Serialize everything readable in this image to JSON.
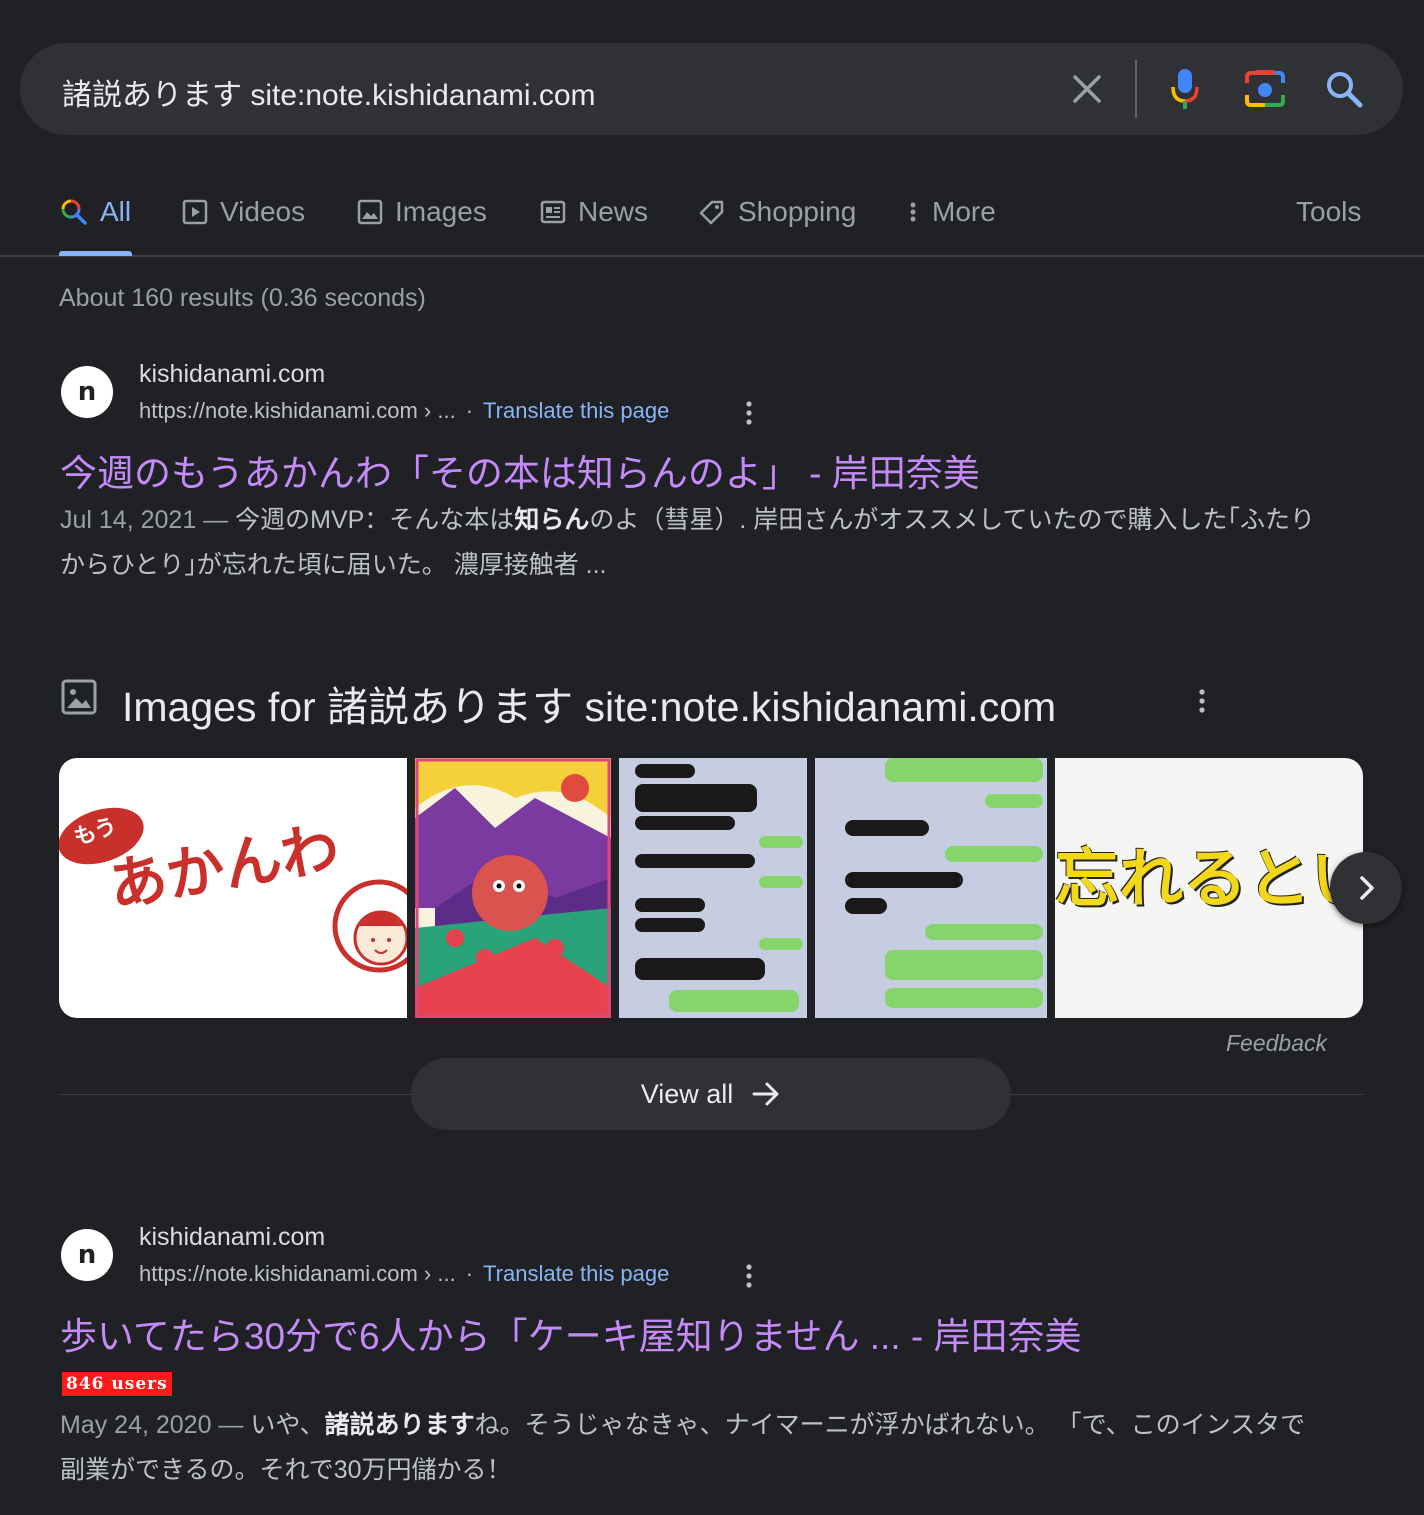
{
  "search": {
    "query": "諸説あります site:note.kishidanami.com"
  },
  "tabs": [
    {
      "label": "All",
      "active": true
    },
    {
      "label": "Videos"
    },
    {
      "label": "Images"
    },
    {
      "label": "News"
    },
    {
      "label": "Shopping"
    },
    {
      "label": "More"
    }
  ],
  "tools_label": "Tools",
  "stats": "About 160 results (0.36 seconds)",
  "results": [
    {
      "favicon_letter": "n",
      "site": "kishidanami.com",
      "url": "https://note.kishidanami.com › ...",
      "dot": "·",
      "translate": "Translate this page",
      "title": "今週のもうあかんわ「その本は知らんのよ」 - 岸田奈美",
      "snippet_date": "Jul 14, 2021 — ",
      "snippet_a": "今週のMVP：そんな本は",
      "snippet_bold": "知らん",
      "snippet_b": "のよ（彗星）. 岸田さんがオススメしていたので購入した｢ふたりからひとり｣が忘れた頃に届いた。 濃厚接触者 ..."
    },
    {
      "favicon_letter": "n",
      "site": "kishidanami.com",
      "url": "https://note.kishidanami.com › ...",
      "dot": "·",
      "translate": "Translate this page",
      "title": "歩いてたら30分で6人から「ケーキ屋知りません ... - 岸田奈美",
      "badge": "846 users",
      "snippet_date": "May 24, 2020 — ",
      "snippet_a": "いや、",
      "snippet_bold": "諸説あります",
      "snippet_b": "ね。そうじゃなきゃ、ナイマーニが浮かばれない。 「で、このインスタで副業ができるの。それで30万円儲かる！"
    }
  ],
  "images_section": {
    "title": "Images for 諸説あります site:note.kishidanami.com",
    "thumb1_small": "もう",
    "thumb1_main": "あかんわ",
    "thumb5_text": "忘れるという",
    "feedback": "Feedback",
    "view_all": "View all"
  },
  "colors": {
    "background": "#202124",
    "link_visited": "#c58af9",
    "accent": "#8ab4f8"
  }
}
